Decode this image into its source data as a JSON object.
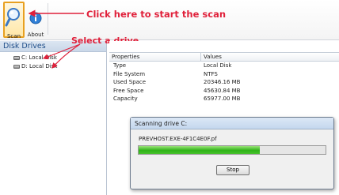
{
  "toolbar": {
    "scan_label": "Scan",
    "about_label": "About",
    "scan_icon": "magnifier-icon",
    "about_icon": "info-icon"
  },
  "annotations": {
    "scan_hint": "Click here to start the scan",
    "drive_hint": "Select a drive",
    "color": "#e0203a"
  },
  "left_panel": {
    "title": "Disk Drives",
    "drives": [
      {
        "label": "C: Local Disk"
      },
      {
        "label": "D: Local Disk"
      }
    ]
  },
  "properties": {
    "col_property": "Properties",
    "col_value": "Values",
    "rows": [
      {
        "name": "Type",
        "value": "Local Disk"
      },
      {
        "name": "File System",
        "value": "NTFS"
      },
      {
        "name": "Used Space",
        "value": "20346.16 MB"
      },
      {
        "name": "Free Space",
        "value": "45630.84 MB"
      },
      {
        "name": "Capacity",
        "value": "65977.00 MB"
      }
    ]
  },
  "dialog": {
    "title": "Scanning drive C:",
    "current_file": "PREVHOST.EXE-4F1C4E0F.pf",
    "progress_fraction": 0.65,
    "stop_label": "Stop"
  }
}
